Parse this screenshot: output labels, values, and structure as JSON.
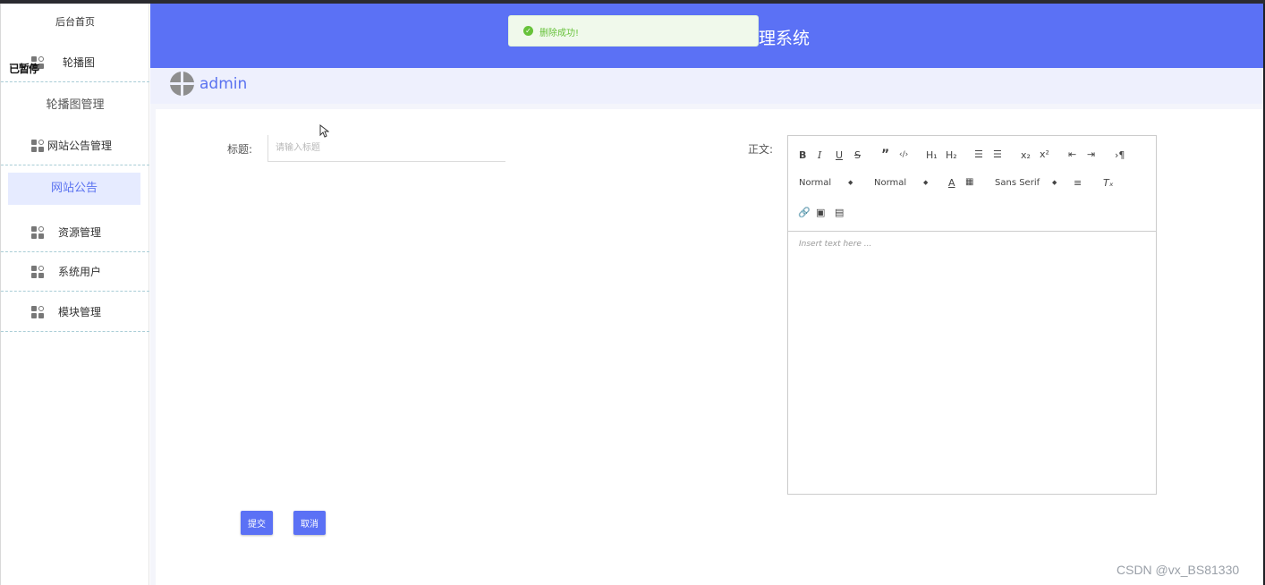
{
  "sidebar": {
    "home": "后台首页",
    "overlay_text": "已暂停",
    "items": [
      {
        "label": "轮播图",
        "icon": "grid-icon"
      },
      {
        "label": "网站公告管理",
        "icon": "grid-icon"
      },
      {
        "label": "资源管理",
        "icon": "grid-icon"
      },
      {
        "label": "系统用户",
        "icon": "grid-icon"
      },
      {
        "label": "模块管理",
        "icon": "grid-icon"
      }
    ],
    "sub_carousel": "轮播图管理",
    "sub_notice": "网站公告"
  },
  "header": {
    "title": "理系统",
    "user": "admin"
  },
  "toast": {
    "message": "删除成功!"
  },
  "form": {
    "title_label": "标题:",
    "title_placeholder": "请输入标题",
    "body_label": "正文:",
    "submit": "提交",
    "cancel": "取消"
  },
  "editor": {
    "header_select": "Normal",
    "size_select": "Normal",
    "font_select": "Sans Serif",
    "placeholder": "Insert text here ..."
  },
  "watermark": "CSDN @vx_BS81330",
  "colors": {
    "accent": "#5b71f5",
    "success": "#67c23a",
    "active_bg": "#e6ebff"
  }
}
